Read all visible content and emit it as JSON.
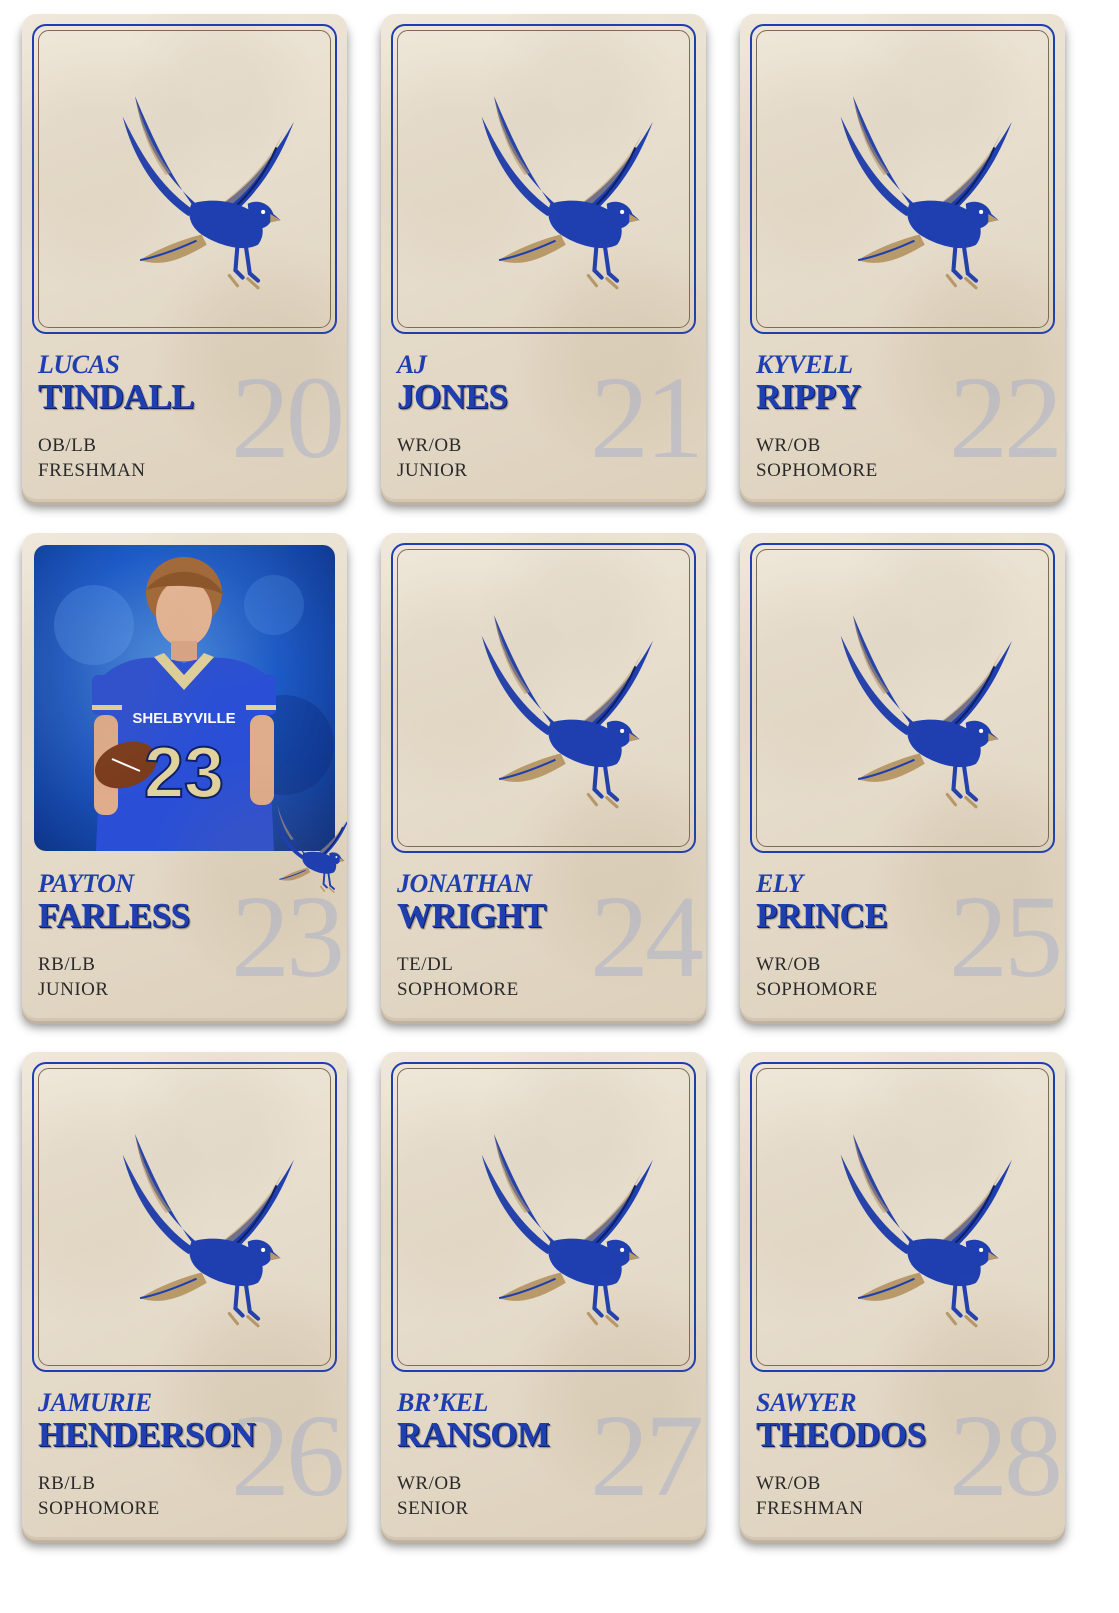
{
  "colors": {
    "primary_blue": "#1f3fb0",
    "gold": "#b89a6a",
    "card_paper": "#e9e0d0"
  },
  "mascot_icon": "hawk-logo",
  "players": [
    {
      "first": "LUCAS",
      "last": "TINDALL",
      "number": "20",
      "position": "OB/LB",
      "year": "FRESHMAN",
      "has_photo": false
    },
    {
      "first": "AJ",
      "last": "JONES",
      "number": "21",
      "position": "WR/OB",
      "year": "JUNIOR",
      "has_photo": false
    },
    {
      "first": "KYVELL",
      "last": "RIPPY",
      "number": "22",
      "position": "WR/OB",
      "year": "SOPHOMORE",
      "has_photo": false
    },
    {
      "first": "PAYTON",
      "last": "FARLESS",
      "number": "23",
      "position": "RB/LB",
      "year": "JUNIOR",
      "has_photo": true,
      "jersey_text": "SHELBYVILLE",
      "jersey_number": "23"
    },
    {
      "first": "JONATHAN",
      "last": "WRIGHT",
      "number": "24",
      "position": "TE/DL",
      "year": "SOPHOMORE",
      "has_photo": false
    },
    {
      "first": "ELY",
      "last": "PRINCE",
      "number": "25",
      "position": "WR/OB",
      "year": "SOPHOMORE",
      "has_photo": false
    },
    {
      "first": "JAMURIE",
      "last": "HENDERSON",
      "number": "26",
      "position": "RB/LB",
      "year": "SOPHOMORE",
      "has_photo": false
    },
    {
      "first": "BR’KEL",
      "last": "RANSOM",
      "number": "27",
      "position": "WR/OB",
      "year": "SENIOR",
      "has_photo": false
    },
    {
      "first": "SAWYER",
      "last": "THEODOS",
      "number": "28",
      "position": "WR/OB",
      "year": "FRESHMAN",
      "has_photo": false
    }
  ]
}
